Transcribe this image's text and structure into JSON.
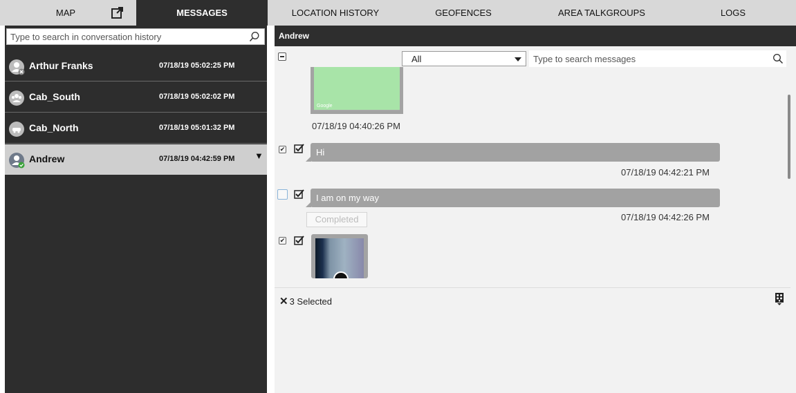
{
  "nav": {
    "tabs": [
      {
        "label": "MAP"
      },
      {
        "label": "MESSAGES"
      },
      {
        "label": "LOCATION HISTORY"
      },
      {
        "label": "GEOFENCES"
      },
      {
        "label": "AREA TALKGROUPS"
      },
      {
        "label": "LOGS"
      }
    ],
    "active_tab": "MESSAGES"
  },
  "conversations": {
    "search_placeholder": "Type to search in conversation history",
    "items": [
      {
        "name": "Arthur Franks",
        "time": "07/18/19 05:02:25 PM",
        "avatar": "user-avatar-icon"
      },
      {
        "name": "Cab_South",
        "time": "07/18/19 05:02:02 PM",
        "avatar": "group-avatar-icon"
      },
      {
        "name": "Cab_North",
        "time": "07/18/19 05:01:32 PM",
        "avatar": "group-avatar-icon"
      },
      {
        "name": "Andrew",
        "time": "07/18/19 04:42:59 PM",
        "avatar": "user-online-avatar-icon",
        "selected": true
      }
    ]
  },
  "chat": {
    "title": "Andrew",
    "filter_value": "All",
    "search_placeholder": "Type to search messages",
    "map_image": {
      "caption_google": "Google",
      "time": "07/18/19 04:40:26 PM"
    },
    "messages": [
      {
        "text": "Hi",
        "time": "07/18/19 04:42:21 PM",
        "checked": true
      },
      {
        "text": "I am on my way",
        "time": "07/18/19 04:42:26 PM",
        "checked": false,
        "tooltip": "Completed"
      }
    ],
    "video": {
      "checked": true
    },
    "selected_count": "3 Selected"
  },
  "colors": {
    "dark_panel": "#2d2d2d",
    "nav_bg": "#d8d8d8",
    "bubble": "#a2a2a2",
    "selected_row": "#cfcfcf"
  }
}
